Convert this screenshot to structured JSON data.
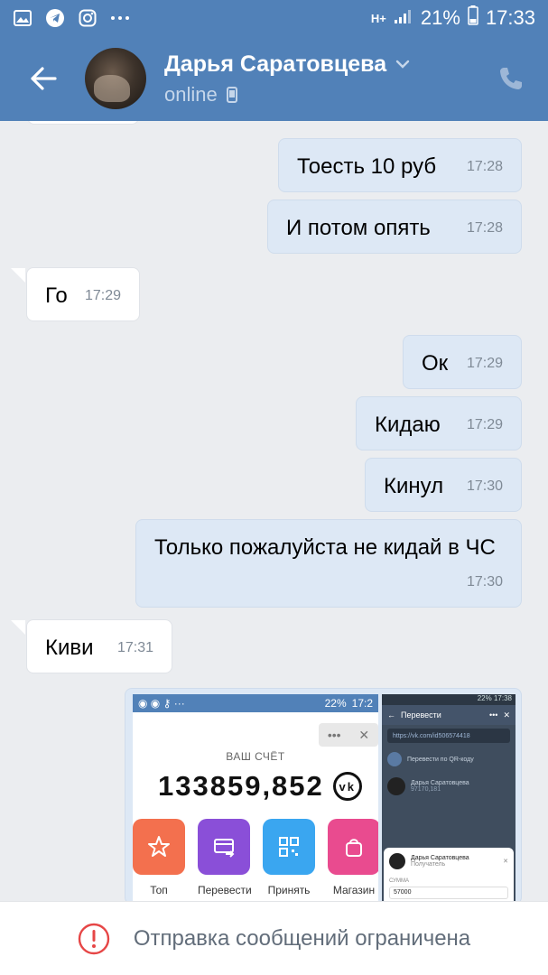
{
  "status_bar": {
    "icons": [
      "gallery-icon",
      "telegram-icon",
      "instagram-icon",
      "more-icon"
    ],
    "network": "H+",
    "battery": "21%",
    "time": "17:33"
  },
  "header": {
    "name": "Дарья Саратовцева",
    "status": "online"
  },
  "messages": [
    {
      "dir": "out",
      "text": "Тоесть 10 руб",
      "time": "17:28"
    },
    {
      "dir": "out",
      "text": "И потом опять",
      "time": "17:28"
    },
    {
      "dir": "in",
      "text": "Го",
      "time": "17:29"
    },
    {
      "dir": "out",
      "text": "Ок",
      "time": "17:29"
    },
    {
      "dir": "out",
      "text": "Кидаю",
      "time": "17:29"
    },
    {
      "dir": "out",
      "text": "Кинул",
      "time": "17:30"
    },
    {
      "dir": "out",
      "text": "Только пожалуйста не кидай в ЧС",
      "time": "17:30"
    },
    {
      "dir": "in",
      "text": "Киви",
      "time": "17:31"
    }
  ],
  "attachment": {
    "shot1": {
      "status_battery": "22%",
      "status_time": "17:2",
      "account_label": "ВАШ СЧЁТ",
      "balance": "133859,852",
      "vk_badge": "vk",
      "tiles": [
        {
          "label": "Топ",
          "color": "#f3704e",
          "icon": "star-icon"
        },
        {
          "label": "Перевести",
          "color": "#8a4fd8",
          "icon": "transfer-icon"
        },
        {
          "label": "Принять",
          "color": "#3aa6f0",
          "icon": "qr-icon"
        },
        {
          "label": "Магазин",
          "color": "#e94b8f",
          "icon": "bag-icon"
        }
      ]
    },
    "shot2": {
      "status": "22% 17:38",
      "title": "Перевести",
      "url": "https://vk.com/id506574418",
      "qr_label": "Перевести по QR-коду",
      "contact_name": "Дарья Саратовцева",
      "contact_sub": "97170,181",
      "card_name": "Дарья Саратовцева",
      "card_role": "Получатель",
      "card_sum_label": "СУММА",
      "card_sum": "57000"
    }
  },
  "footer": {
    "text": "Отправка сообщений ограничена"
  },
  "colors": {
    "header_bg": "#5181b8",
    "chat_bg": "#ebedf0",
    "outgoing_bubble": "#dde8f5",
    "incoming_bubble": "#ffffff",
    "warning_red": "#e64646"
  }
}
